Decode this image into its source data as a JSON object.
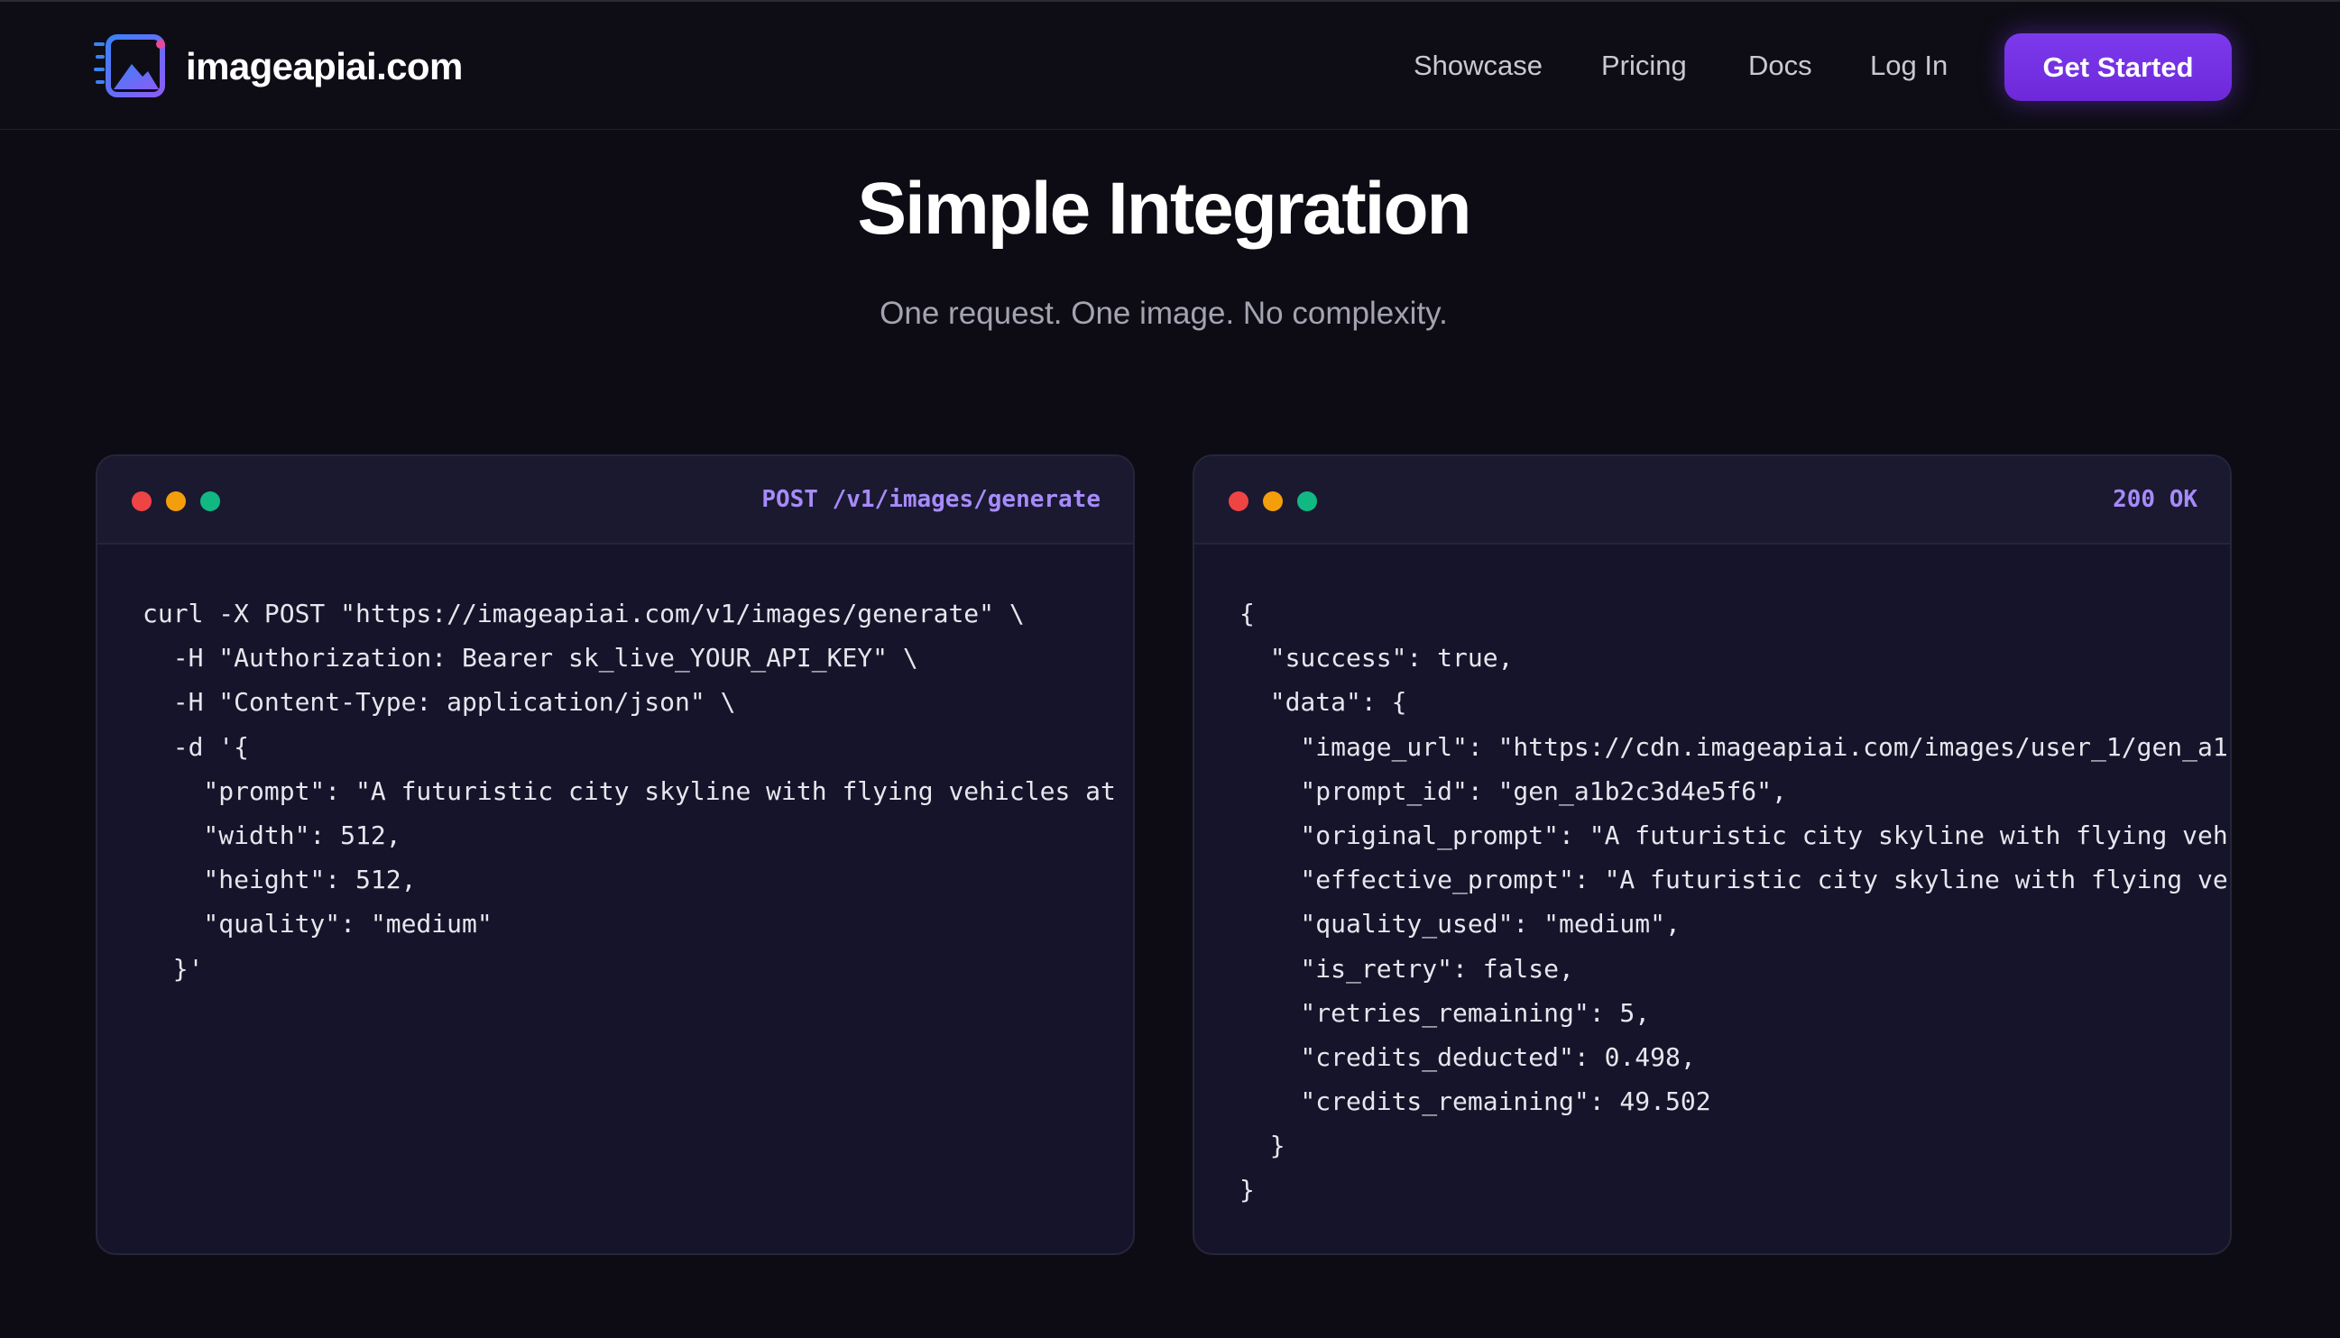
{
  "header": {
    "brand": "imageapiai.com",
    "logo_icon": "image-logo-icon",
    "nav": [
      {
        "label": "Showcase"
      },
      {
        "label": "Pricing"
      },
      {
        "label": "Docs"
      },
      {
        "label": "Log In"
      }
    ],
    "cta_label": "Get Started",
    "accent_color": "#7c3aed"
  },
  "hero": {
    "title": "Simple Integration",
    "subtitle": "One request. One image. No complexity."
  },
  "request_panel": {
    "tag": "POST /v1/images/generate",
    "lines": [
      "curl -X POST \"https://imageapiai.com/v1/images/generate\" \\",
      "  -H \"Authorization: Bearer sk_live_YOUR_API_KEY\" \\",
      "  -H \"Content-Type: application/json\" \\",
      "  -d '{",
      "    \"prompt\": \"A futuristic city skyline with flying vehicles at",
      "    \"width\": 512,",
      "    \"height\": 512,",
      "    \"quality\": \"medium\"",
      "  }'"
    ]
  },
  "response_panel": {
    "tag": "200 OK",
    "lines": [
      "{",
      "  \"success\": true,",
      "  \"data\": {",
      "    \"image_url\": \"https://cdn.imageapiai.com/images/user_1/gen_a1",
      "    \"prompt_id\": \"gen_a1b2c3d4e5f6\",",
      "    \"original_prompt\": \"A futuristic city skyline with flying veh",
      "    \"effective_prompt\": \"A futuristic city skyline with flying ve",
      "    \"quality_used\": \"medium\",",
      "    \"is_retry\": false,",
      "    \"retries_remaining\": 5,",
      "    \"credits_deducted\": 0.498,",
      "    \"credits_remaining\": 49.502",
      "  }",
      "}"
    ]
  },
  "window_dot_colors": [
    "#ef4444",
    "#f59e0b",
    "#10b981"
  ]
}
